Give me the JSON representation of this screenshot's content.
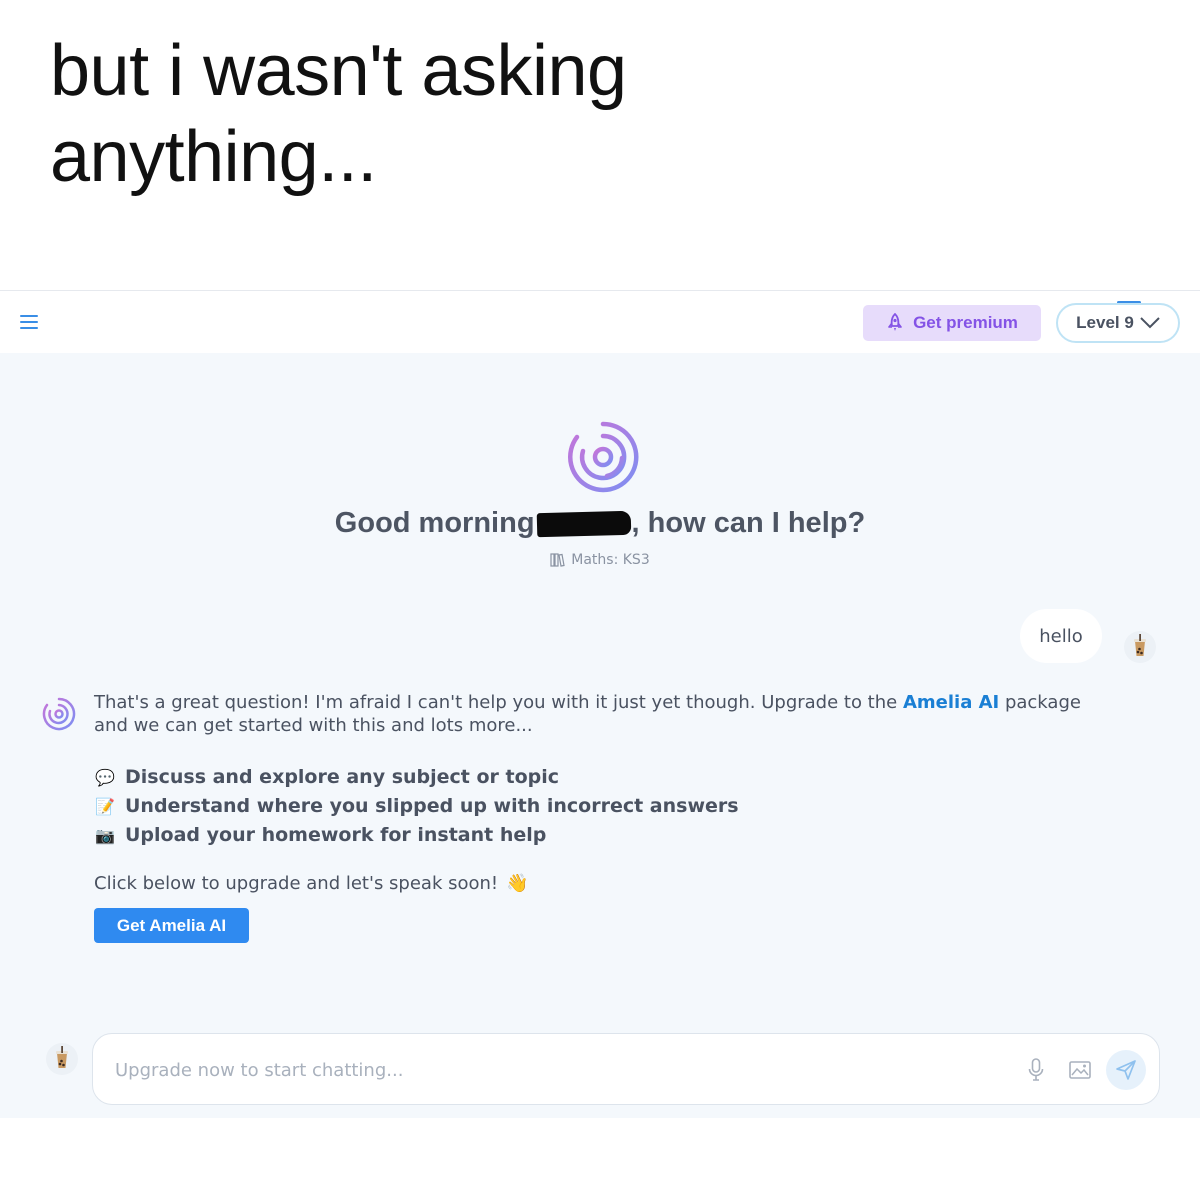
{
  "caption": {
    "line1": "but i wasn't asking",
    "line2": "anything..."
  },
  "header": {
    "menu_icon": "hamburger-menu-icon",
    "premium_label": "Get premium",
    "premium_icon": "rocket-icon",
    "level_label": "Level 9",
    "level_icon": "chevron-down-icon"
  },
  "greeting": {
    "prefix": "Good morning",
    "suffix": ", how can I help?",
    "subject": "Maths: KS3",
    "subject_icon": "books-icon"
  },
  "conversation": {
    "user_message": "hello",
    "user_avatar": "bubble-tea-avatar",
    "bot_avatar": "amelia-logo-icon",
    "bot_intro": "That's a great question! I'm afraid I can't help you with it just yet though. Upgrade to the ",
    "bot_link": "Amelia AI",
    "bot_intro_end": " package and we can get started with this and lots more...",
    "features": [
      {
        "icon": "💬",
        "text": "Discuss and explore any subject or topic"
      },
      {
        "icon": "📝",
        "text": "Understand where you slipped up with incorrect answers"
      },
      {
        "icon": "📷",
        "text": "Upload your homework for instant help"
      }
    ],
    "cta_text": "Click below to upgrade and let's speak soon!",
    "cta_emoji": "👋",
    "cta_button": "Get Amelia AI"
  },
  "composer": {
    "placeholder": "Upgrade now to start chatting...",
    "mic_icon": "microphone-icon",
    "image_icon": "image-icon",
    "send_icon": "send-icon"
  },
  "colors": {
    "accent_blue": "#2f8af0",
    "premium_purple": "#8453e6",
    "premium_bg": "#e7dcfb",
    "app_bg": "#f4f8fc"
  }
}
